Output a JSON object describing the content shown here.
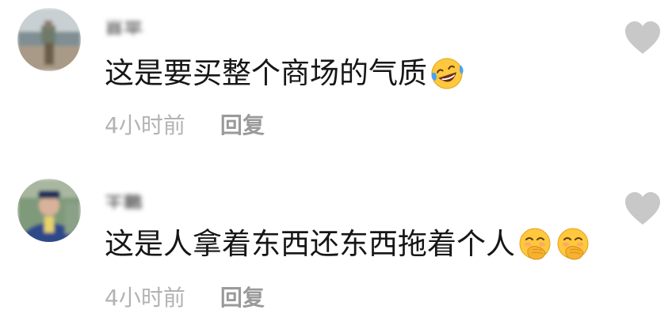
{
  "comments": [
    {
      "username": "肖平",
      "text": "这是要买整个商场的气质",
      "emojis": [
        "tears-of-joy-emoji"
      ],
      "timestamp": "4小时前",
      "reply_label": "回复"
    },
    {
      "username": "王鹏",
      "text": "这是人拿着东西还东西拖着个人",
      "emojis": [
        "hand-over-mouth-emoji",
        "hand-over-mouth-emoji"
      ],
      "timestamp": "4小时前",
      "reply_label": "回复"
    }
  ],
  "colors": {
    "text": "#161616",
    "timestamp": "#b3b3b3",
    "reply": "#9a9a9a",
    "like_icon": "#c8c8c8",
    "emoji_face": "#ffc83d"
  }
}
